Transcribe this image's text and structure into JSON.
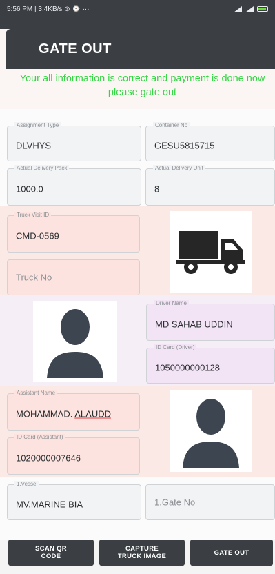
{
  "status_bar": {
    "left_text": "5:56 PM | 3.4KB/s ⊙ ⌚  ···"
  },
  "header": {
    "title": "GATE OUT"
  },
  "banner": {
    "message": "Your all information is correct and payment is done now please gate out"
  },
  "fields": {
    "assignment_type": {
      "label": "Assignment Type",
      "value": "DLVHYS"
    },
    "container_no": {
      "label": "Container No",
      "value": "GESU5815715"
    },
    "actual_delivery_pack": {
      "label": "Actual Delivery Pack",
      "value": "1000.0"
    },
    "actual_delivery_unit": {
      "label": "Actual Delivery Unit",
      "value": "8"
    },
    "truck_visit_id": {
      "label": "Truck Visit ID",
      "value": "CMD-0569"
    },
    "truck_no": {
      "placeholder": "Truck No"
    },
    "driver_name": {
      "label": "Driver Name",
      "value": "MD SAHAB UDDIN"
    },
    "id_card_driver": {
      "label": "ID Card (Driver)",
      "value": "1050000000128"
    },
    "assistant_name": {
      "label": "Assistant Name",
      "value_part1": "MOHAMMAD.",
      "value_part2": "ALAUDD"
    },
    "id_card_assistant": {
      "label": "ID Card (Assistant)",
      "value": "1020000007646"
    },
    "vessel": {
      "label": "1.Vessel",
      "value": "MV.MARINE BIA"
    },
    "gate_no": {
      "placeholder": "1.Gate No"
    }
  },
  "buttons": {
    "scan_qr": {
      "line1": "SCAN QR",
      "line2": "CODE"
    },
    "capture_truck": {
      "line1": "CAPTURE",
      "line2": "TRUCK IMAGE"
    },
    "gate_out": {
      "label": "GATE OUT"
    }
  },
  "colors": {
    "primary": "#3b3f44",
    "success_text": "#35d545",
    "pink_bg": "#fbe9e6",
    "lavender_bg": "#f5eef7"
  }
}
